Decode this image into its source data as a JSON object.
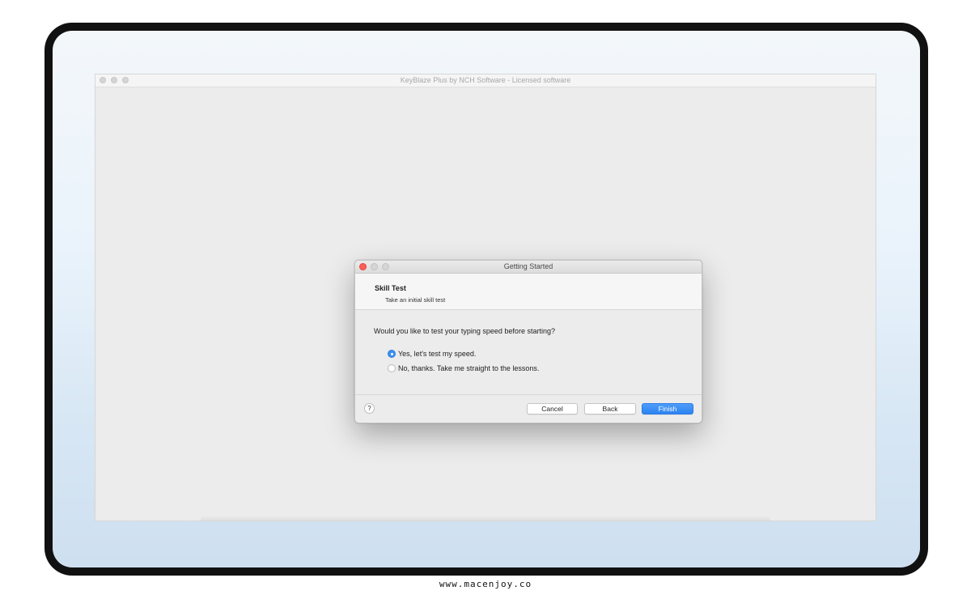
{
  "app": {
    "title": "KeyBlaze Plus by NCH Software - Licensed software"
  },
  "dialog": {
    "title": "Getting Started",
    "heading": "Skill Test",
    "subheading": "Take an initial skill test",
    "question": "Would you like to test your typing speed before starting?",
    "options": [
      {
        "label": "Yes, let's test my speed.",
        "selected": true
      },
      {
        "label": "No, thanks. Take me straight to the lessons.",
        "selected": false
      }
    ],
    "buttons": {
      "help": "?",
      "cancel": "Cancel",
      "back": "Back",
      "finish": "Finish"
    }
  },
  "watermark": "www.macenjoy.co",
  "colors": {
    "accent": "#2d84f1",
    "close_light": "#fc5f57",
    "frame": "#111111"
  }
}
